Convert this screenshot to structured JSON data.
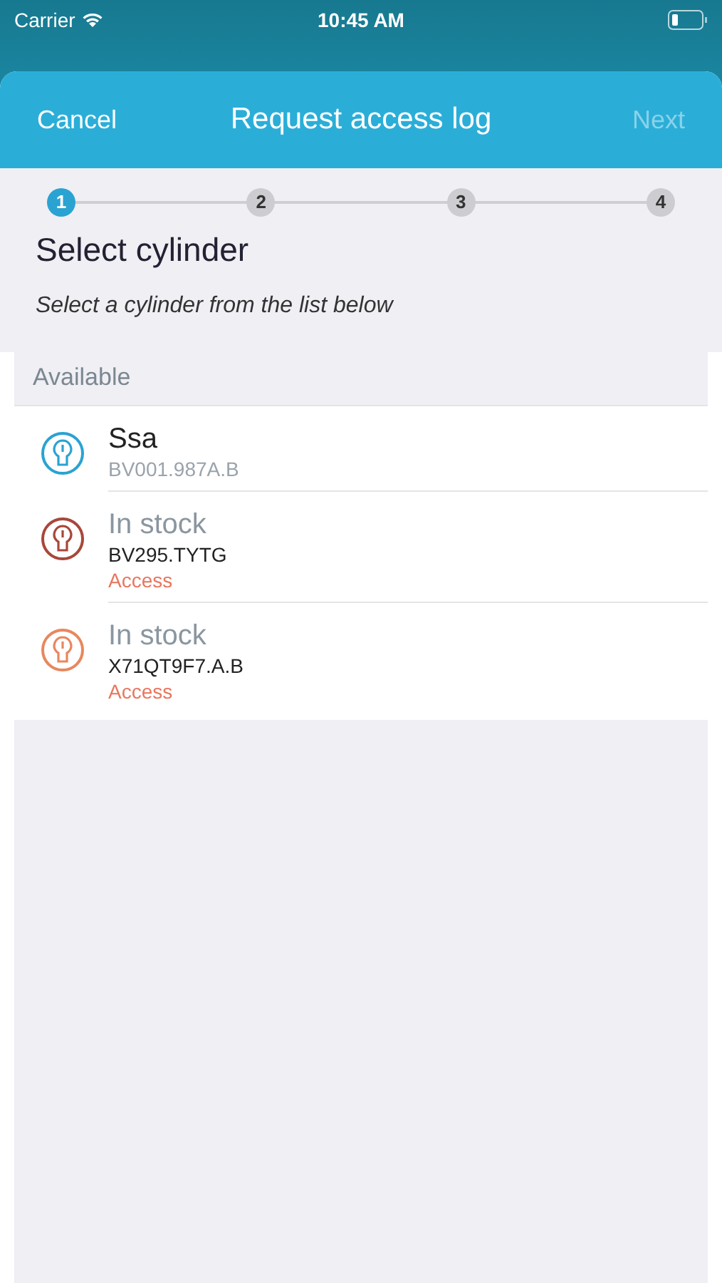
{
  "status_bar": {
    "carrier": "Carrier",
    "time": "10:45 AM"
  },
  "sheet": {
    "cancel": "Cancel",
    "title": "Request access log",
    "next": "Next",
    "next_disabled": true
  },
  "steps": [
    {
      "label": "1",
      "selected": true
    },
    {
      "label": "2",
      "selected": false
    },
    {
      "label": "3",
      "selected": false
    },
    {
      "label": "4",
      "selected": false
    }
  ],
  "heading": "Select cylinder",
  "subheading": "Select a cylinder from the list below",
  "section": "Available",
  "cylinders": [
    {
      "kind": "named",
      "name": "Ssa",
      "code": "BV001.987A.B",
      "color": "#2aa3d2"
    },
    {
      "kind": "stock",
      "name": "In stock",
      "code": "BV295.TYTG",
      "status": "Access",
      "color": "#a8473a"
    },
    {
      "kind": "stock",
      "name": "In stock",
      "code": "X71QT9F7.A.B",
      "status": "Access",
      "color": "#e8875e"
    }
  ]
}
